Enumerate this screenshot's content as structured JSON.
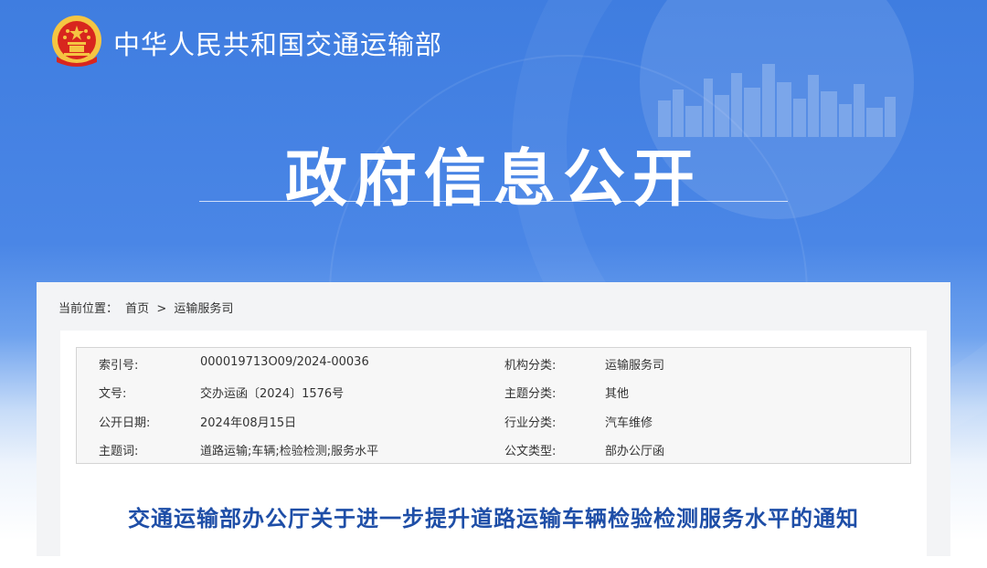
{
  "header": {
    "site_title": "中华人民共和国交通运输部",
    "page_title": "政府信息公开"
  },
  "breadcrumb": {
    "label": "当前位置：",
    "home": "首页",
    "separator": ">",
    "current": "运输服务司"
  },
  "meta": [
    {
      "k1": "索引号:",
      "v1": "000019713O09/2024-00036",
      "k2": "机构分类:",
      "v2": "运输服务司"
    },
    {
      "k1": "文号:",
      "v1": "交办运函〔2024〕1576号",
      "k2": "主题分类:",
      "v2": "其他"
    },
    {
      "k1": "公开日期:",
      "v1": "2024年08月15日",
      "k2": "行业分类:",
      "v2": "汽车维修"
    },
    {
      "k1": "主题词:",
      "v1": "道路运输;车辆;检验检测;服务水平",
      "k2": "公文类型:",
      "v2": "部办公厅函"
    }
  ],
  "document": {
    "title": "交通运输部办公厅关于进一步提升道路运输车辆检验检测服务水平的通知"
  },
  "colors": {
    "banner_blue": "#3f7de0",
    "title_blue": "#1e4ea7",
    "emblem_red": "#d8261e",
    "emblem_gold": "#f5c542"
  }
}
